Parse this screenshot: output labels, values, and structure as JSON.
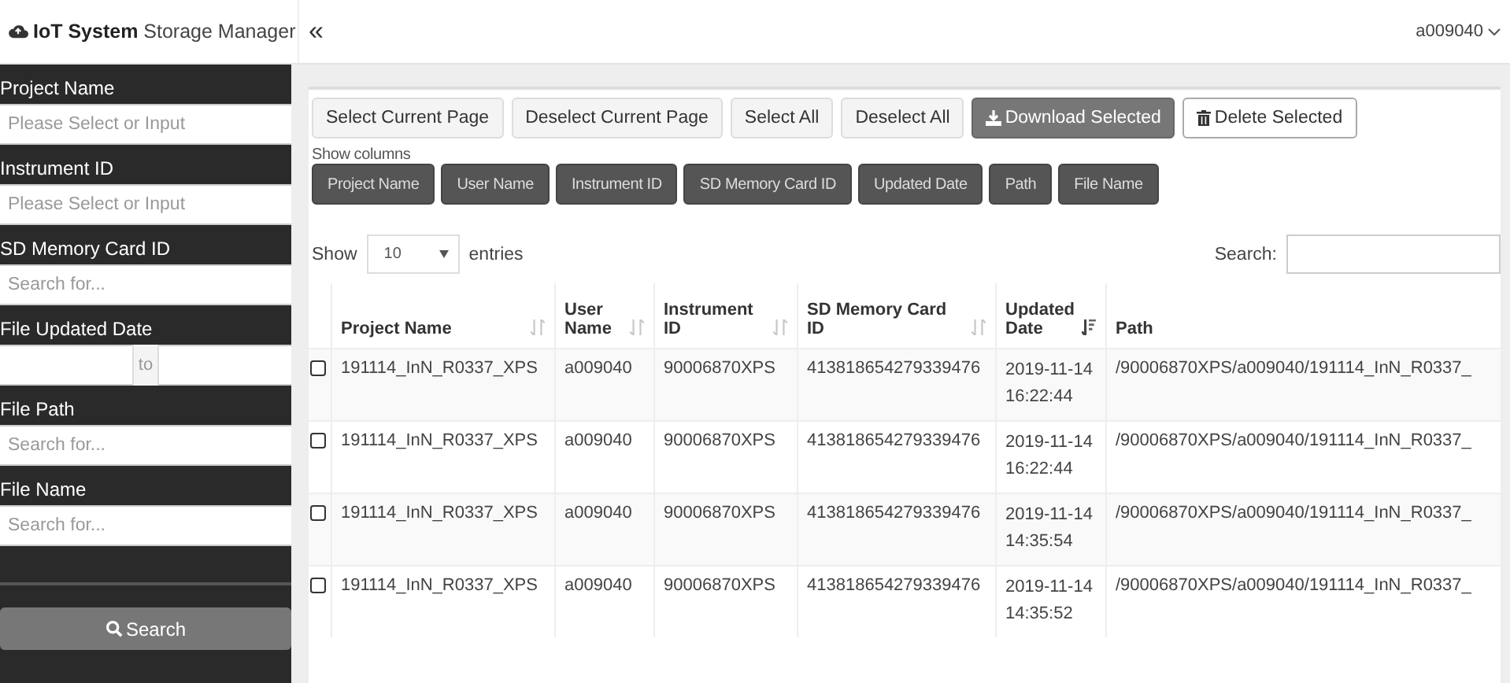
{
  "header": {
    "brand": "**IoT System** Storage Manager",
    "collapse": "«",
    "user": "a009040"
  },
  "sidebar": {
    "filters": [
      {
        "kind": "text",
        "label": "Project Name",
        "placeholder": "Please Select or Input"
      },
      {
        "kind": "text",
        "label": "Instrument ID",
        "placeholder": "Please Select or Input"
      },
      {
        "kind": "text",
        "label": "SD Memory Card ID",
        "placeholder": "Search for..."
      },
      {
        "kind": "range",
        "label": "File Updated Date",
        "separator": "to"
      },
      {
        "kind": "text",
        "label": "File Path",
        "placeholder": "Search for..."
      },
      {
        "kind": "text",
        "label": "File Name",
        "placeholder": "Search for..."
      }
    ],
    "search_button": "Search"
  },
  "toolbar": {
    "buttons": [
      {
        "kind": "plain",
        "label": "Select Current Page"
      },
      {
        "kind": "plain",
        "label": "Deselect Current Page"
      },
      {
        "kind": "plain",
        "label": "Select All"
      },
      {
        "kind": "plain",
        "label": "Deselect All"
      },
      {
        "kind": "download",
        "label": "Download Selected"
      },
      {
        "kind": "delete",
        "label": "Delete Selected"
      }
    ],
    "show_columns_label": "Show columns",
    "column_toggles": [
      {
        "label": "Project Name",
        "on": true
      },
      {
        "label": "User Name",
        "on": true
      },
      {
        "label": "Instrument ID",
        "on": true
      },
      {
        "label": "SD Memory Card ID",
        "on": true
      },
      {
        "label": "Updated Date",
        "on": true
      },
      {
        "label": "Path",
        "on": true
      },
      {
        "label": "File Name",
        "on": true
      }
    ]
  },
  "length": {
    "show": "Show",
    "value": "10",
    "entries": "entries"
  },
  "search": {
    "label": "Search:"
  },
  "table": {
    "columns": [
      {
        "label": "Project Name",
        "sortable": true,
        "sorted": false
      },
      {
        "label": "User Name",
        "sortable": true,
        "sorted": false
      },
      {
        "label": "Instrument ID",
        "sortable": true,
        "sorted": false
      },
      {
        "label": "SD Memory Card ID",
        "sortable": true,
        "sorted": false
      },
      {
        "label": "Updated Date",
        "sortable": true,
        "sorted": true
      },
      {
        "label": "Path",
        "sortable": false
      }
    ],
    "rows": [
      {
        "checked": false,
        "cells": [
          "191114_InN_R0337_XPS",
          "a009040",
          "90006870XPS",
          "413818654279339476",
          "2019-11-14 16:22:44",
          "/90006870XPS/a009040/191114_InN_R0337_"
        ]
      },
      {
        "checked": false,
        "cells": [
          "191114_InN_R0337_XPS",
          "a009040",
          "90006870XPS",
          "413818654279339476",
          "2019-11-14 16:22:44",
          "/90006870XPS/a009040/191114_InN_R0337_"
        ]
      },
      {
        "checked": false,
        "cells": [
          "191114_InN_R0337_XPS",
          "a009040",
          "90006870XPS",
          "413818654279339476",
          "2019-11-14 14:35:54",
          "/90006870XPS/a009040/191114_InN_R0337_"
        ]
      },
      {
        "checked": false,
        "cells": [
          "191114_InN_R0337_XPS",
          "a009040",
          "90006870XPS",
          "413818654279339476",
          "2019-11-14 14:35:52",
          "/90006870XPS/a009040/191114_InN_R0337_"
        ]
      }
    ]
  }
}
